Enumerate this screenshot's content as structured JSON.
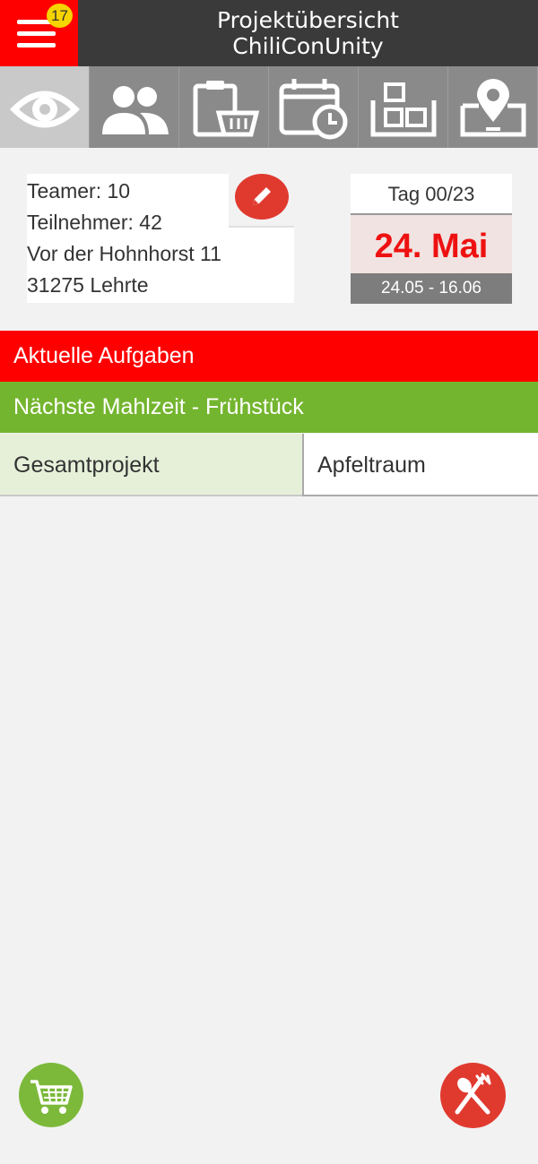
{
  "header": {
    "title_line1": "Projektübersicht",
    "title_line2": "ChiliConUnity",
    "badge_count": "17",
    "accent": "#ff0000"
  },
  "tabs": [
    {
      "icon": "eye-icon",
      "active": true
    },
    {
      "icon": "people-icon",
      "active": false
    },
    {
      "icon": "clipboard-basket-icon",
      "active": false
    },
    {
      "icon": "calendar-clock-icon",
      "active": false
    },
    {
      "icon": "boxes-icon",
      "active": false
    },
    {
      "icon": "map-pin-icon",
      "active": false
    }
  ],
  "info": {
    "teamer": "Teamer: 10",
    "teilnehmer": "Teilnehmer: 42",
    "street": "Vor der Hohnhorst 11",
    "city": "31275 Lehrte"
  },
  "date_card": {
    "day": "Tag 00/23",
    "date": "24. Mai",
    "range": "24.05 - 16.06"
  },
  "sections": {
    "tasks": "Aktuelle Aufgaben",
    "next_meal": "Nächste Mahlzeit - Frühstück"
  },
  "project_tabs": {
    "left": "Gesamtprojekt",
    "right": "Apfeltraum"
  },
  "colors": {
    "red": "#ff0000",
    "green": "#74b52f",
    "fab_red": "#e03a2f",
    "fab_green": "#7cb93a"
  }
}
